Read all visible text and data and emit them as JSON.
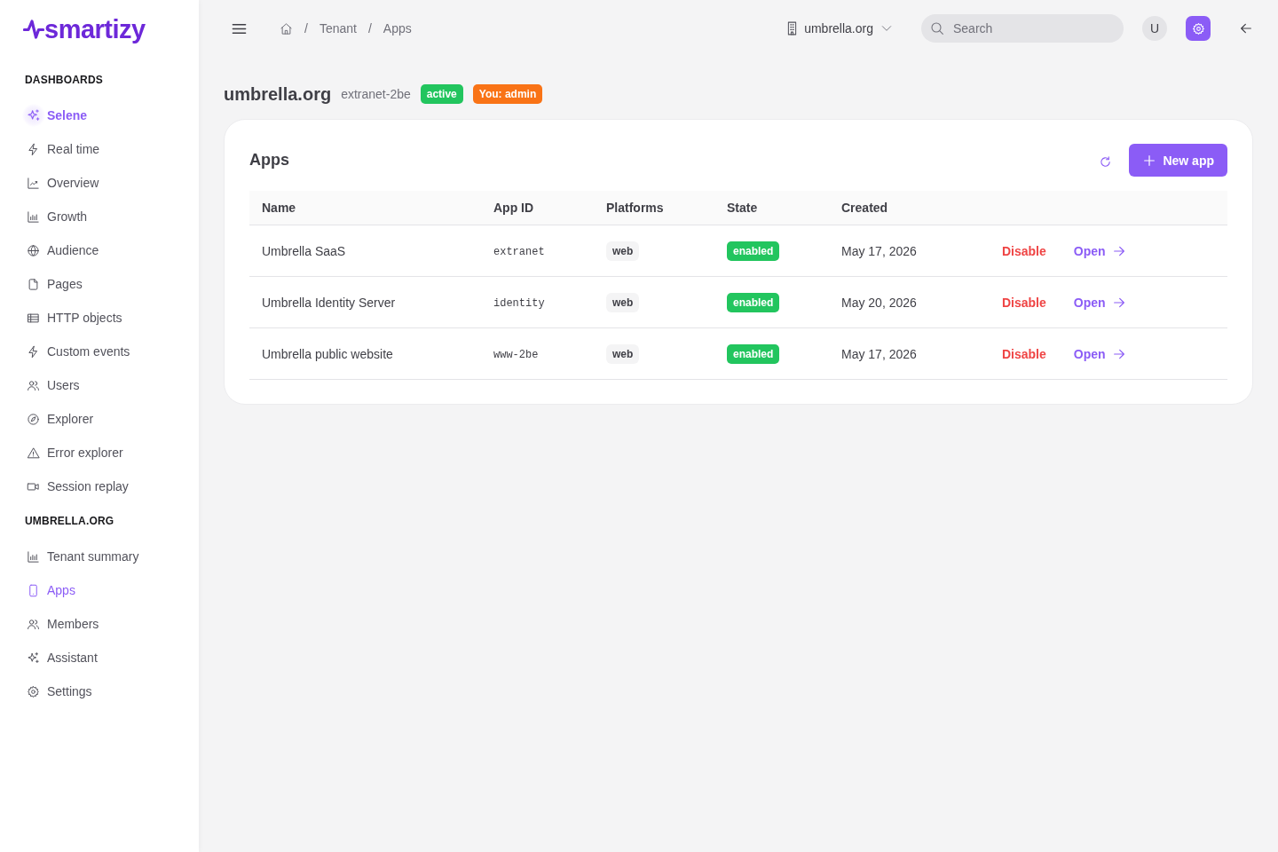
{
  "brand": {
    "name": "smartizy"
  },
  "sidebar": {
    "sections": [
      {
        "title": "DASHBOARDS",
        "items": [
          {
            "label": "Selene",
            "kind": "featured",
            "selected": false
          },
          {
            "label": "Real time",
            "kind": "link",
            "selected": false
          },
          {
            "label": "Overview",
            "kind": "link",
            "selected": false
          },
          {
            "label": "Growth",
            "kind": "link",
            "selected": false
          },
          {
            "label": "Audience",
            "kind": "link",
            "selected": false
          },
          {
            "label": "Pages",
            "kind": "link",
            "selected": false
          },
          {
            "label": "HTTP objects",
            "kind": "link",
            "selected": false
          },
          {
            "label": "Custom events",
            "kind": "link",
            "selected": false
          },
          {
            "label": "Users",
            "kind": "link",
            "selected": false
          },
          {
            "label": "Explorer",
            "kind": "link",
            "selected": false
          },
          {
            "label": "Error explorer",
            "kind": "link",
            "selected": false
          },
          {
            "label": "Session replay",
            "kind": "link",
            "selected": false
          }
        ]
      },
      {
        "title": "UMBRELLA.ORG",
        "items": [
          {
            "label": "Tenant summary",
            "kind": "link",
            "selected": false
          },
          {
            "label": "Apps",
            "kind": "link",
            "selected": true
          },
          {
            "label": "Members",
            "kind": "link",
            "selected": false
          },
          {
            "label": "Assistant",
            "kind": "link",
            "selected": false
          },
          {
            "label": "Settings",
            "kind": "link",
            "selected": false
          }
        ]
      }
    ]
  },
  "topbar": {
    "breadcrumb": [
      {
        "separator": "/",
        "label": "Tenant"
      },
      {
        "separator": "/",
        "label": "Apps"
      }
    ],
    "tenant_switcher": {
      "label": "umbrella.org"
    },
    "search": {
      "placeholder": "Search"
    },
    "avatar": {
      "initial": "U"
    }
  },
  "header": {
    "title": "umbrella.org",
    "slug": "extranet-2be",
    "badges": [
      {
        "label": "active",
        "color": "#22c55e"
      },
      {
        "label": "You: admin",
        "color": "#f97316"
      }
    ]
  },
  "apps_card": {
    "title": "Apps",
    "new_button": {
      "label": "New app"
    },
    "table": {
      "columns": [
        "Name",
        "App ID",
        "Platforms",
        "State",
        "Created"
      ],
      "rows": [
        {
          "name": "Umbrella SaaS",
          "app_id": "extranet",
          "platforms": [
            "web"
          ],
          "state": "enabled",
          "enabled": true,
          "created": "May 17, 2026",
          "actions": [
            {
              "label": "Disable",
              "kind": "danger"
            },
            {
              "label": "Open",
              "kind": "link"
            }
          ]
        },
        {
          "name": "Umbrella Identity Server",
          "app_id": "identity",
          "platforms": [
            "web"
          ],
          "state": "enabled",
          "enabled": true,
          "created": "May 20, 2026",
          "actions": [
            {
              "label": "Disable",
              "kind": "danger"
            },
            {
              "label": "Open",
              "kind": "link"
            }
          ]
        },
        {
          "name": "Umbrella public website",
          "app_id": "www-2be",
          "platforms": [
            "web"
          ],
          "state": "enabled",
          "enabled": true,
          "created": "May 17, 2026",
          "actions": [
            {
              "label": "Disable",
              "kind": "danger"
            },
            {
              "label": "Open",
              "kind": "link"
            }
          ]
        }
      ]
    }
  }
}
